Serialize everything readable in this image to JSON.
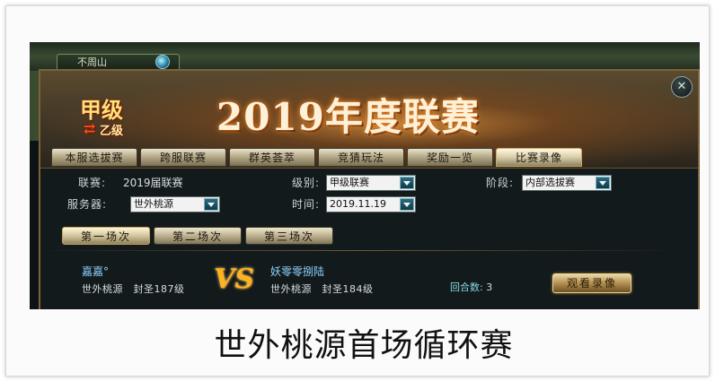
{
  "topbar": {
    "location": "不周山"
  },
  "header": {
    "logo_main": "甲级",
    "logo_sub": "乙级",
    "title": "2019年度联赛",
    "close_glyph": "✕"
  },
  "tabs": [
    {
      "label": "本服选拔赛"
    },
    {
      "label": "跨服联赛"
    },
    {
      "label": "群英荟萃"
    },
    {
      "label": "竞猜玩法"
    },
    {
      "label": "奖励一览"
    },
    {
      "label": "比赛录像",
      "active": true
    }
  ],
  "form": {
    "league_label": "联赛:",
    "league_value": "2019届联赛",
    "level_label": "级别:",
    "level_value": "甲级联赛",
    "stage_label": "阶段:",
    "stage_value": "内部选拔赛",
    "server_label": "服务器:",
    "server_value": "世外桃源",
    "time_label": "时间:",
    "time_value": "2019.11.19"
  },
  "subtabs": [
    {
      "label": "第一场次",
      "active": true
    },
    {
      "label": "第二场次"
    },
    {
      "label": "第三场次"
    }
  ],
  "match": {
    "player1_name": "嘉嘉°",
    "player1_info": "世外桃源　封圣187级",
    "vs": "VS",
    "player2_name": "妖零零捌陆",
    "player2_info": "世外桃源　封圣184级",
    "rounds_label": "回合数:",
    "rounds_value": "3",
    "watch_label": "观看录像"
  },
  "caption": "世外桃源首场循环赛"
}
